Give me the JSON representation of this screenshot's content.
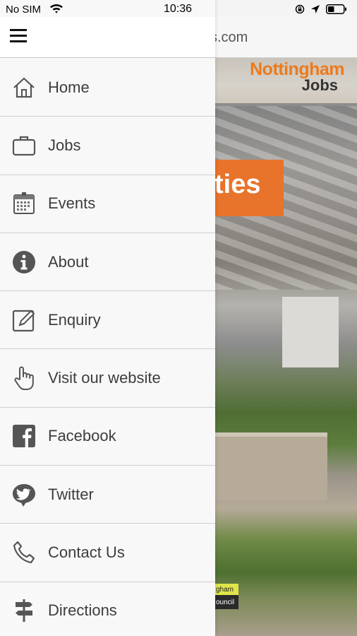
{
  "status_bar": {
    "carrier": "No SIM",
    "time": "10:36",
    "icons": [
      "wifi-icon",
      "orientation-lock-icon",
      "location-arrow-icon",
      "battery-icon"
    ]
  },
  "background_page": {
    "url_fragment": "s.com",
    "logo_line1": "Nottingham",
    "logo_line2": "Jobs",
    "banner_fragment": "ties",
    "council_line1": "gham",
    "council_line2": "ouncil",
    "brand_color": "#ec7a1c"
  },
  "drawer": {
    "menu_icon": "hamburger-icon",
    "items": [
      {
        "label": "Home",
        "icon": "home-icon"
      },
      {
        "label": "Jobs",
        "icon": "briefcase-icon"
      },
      {
        "label": "Events",
        "icon": "calendar-icon"
      },
      {
        "label": "About",
        "icon": "info-icon"
      },
      {
        "label": "Enquiry",
        "icon": "edit-icon"
      },
      {
        "label": "Visit our website",
        "icon": "pointer-hand-icon"
      },
      {
        "label": "Facebook",
        "icon": "facebook-icon"
      },
      {
        "label": "Twitter",
        "icon": "twitter-icon"
      },
      {
        "label": "Contact Us",
        "icon": "phone-icon"
      },
      {
        "label": "Directions",
        "icon": "signpost-icon"
      }
    ]
  }
}
